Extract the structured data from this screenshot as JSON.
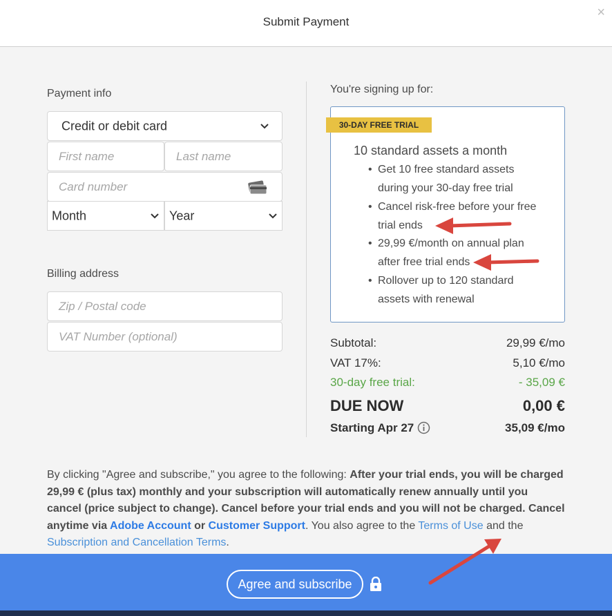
{
  "header": {
    "title": "Submit Payment",
    "close": "×"
  },
  "payment": {
    "section_label": "Payment info",
    "method": "Credit or debit card",
    "first_name_placeholder": "First name",
    "last_name_placeholder": "Last name",
    "card_number_placeholder": "Card number",
    "month": "Month",
    "year": "Year"
  },
  "billing": {
    "section_label": "Billing address",
    "zip_placeholder": "Zip / Postal code",
    "vat_placeholder": "VAT Number (optional)"
  },
  "plan": {
    "signing_up_label": "You're signing up for:",
    "badge": "30-DAY FREE TRIAL",
    "title": "10 standard assets a month",
    "bullet_lines": [
      "Get 10 free standard assets",
      "during your 30-day free trial",
      "Cancel risk-free before your free",
      "trial ends",
      "29,99 €/month on annual plan",
      "after free trial ends",
      "Rollover up to 120 standard",
      "assets with renewal"
    ]
  },
  "summary": {
    "subtotal_label": "Subtotal:",
    "subtotal_value": "29,99 €/mo",
    "vat_label": "VAT 17%:",
    "vat_value": "5,10 €/mo",
    "trial_label": "30-day free trial:",
    "trial_value": "- 35,09 €",
    "due_label": "DUE NOW",
    "due_value": "0,00 €",
    "starting_label": "Starting Apr 27",
    "starting_value": "35,09 €/mo"
  },
  "legal": {
    "t1": "By clicking \"Agree and subscribe,\" you agree to the following: ",
    "t2": "After your trial ends, you will be charged 29,99 € (plus tax) monthly and your subscription will automatically renew annually until you cancel (price subject to change). Cancel before your trial ends and you will not be charged. Cancel anytime via ",
    "link_account": "Adobe Account",
    "t3": " or ",
    "link_support": "Customer Support",
    "t4": ". You also agree to the ",
    "link_terms": "Terms of Use",
    "t5": " and the ",
    "link_sub_terms": "Subscription and Cancellation Terms",
    "t6": "."
  },
  "footer": {
    "agree_label": "Agree and subscribe"
  },
  "colors": {
    "accent": "#4a86e8",
    "badge": "#e8c142",
    "link": "#2d7be5",
    "trial_green": "#5aa648",
    "annotation_arrow": "#d9463e"
  }
}
